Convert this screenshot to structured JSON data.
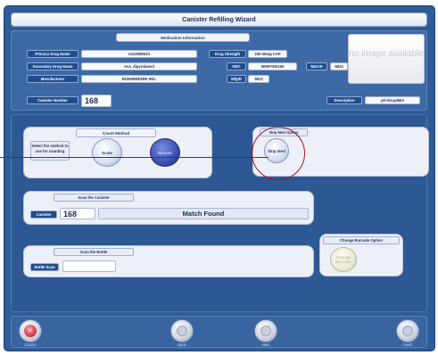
{
  "window": {
    "title": "Canister Refilling Wizard"
  },
  "medication": {
    "header": "Medication Information",
    "primary_drug_name": {
      "label": "Primary Drug Name",
      "value": "AGGRENOX"
    },
    "secondary_drug_name": {
      "label": "Secondary Drug Name",
      "value": "Asa_dipyridamol"
    },
    "manufacturer": {
      "label": "Manufacturer",
      "value": "BOEHRINGER ING."
    },
    "drug_strength": {
      "label": "Drug Strength",
      "value": "200-25mg CAP"
    },
    "ndc": {
      "label": "NDC",
      "value": "00597000160"
    },
    "ndcid": {
      "label": "NDCID",
      "value": "5813"
    },
    "mfgid": {
      "label": "MfgID",
      "value": "5813"
    },
    "canister_number": {
      "label": "Canister Number",
      "value": "168"
    },
    "description": {
      "label": "Description",
      "value": "yel-blcap/BIA"
    },
    "image_placeholder": "no image available"
  },
  "count_method": {
    "header": "Count Method",
    "prompt": "Select the method to use for counting",
    "scale_label": "Scale",
    "manual_label": "Manual"
  },
  "skip_med": {
    "header": "Skip Med Option",
    "button_label": "Skip Med"
  },
  "scan_canister": {
    "header": "Scan the Canister",
    "field_label": "Canister",
    "value": "168",
    "status": "Match Found"
  },
  "scan_bottle": {
    "header": "Scan the Bottle",
    "field_label": "Bottle Scan",
    "value": ""
  },
  "barcode": {
    "header": "Change Barcode Option",
    "button_label": "Change Barcode"
  },
  "footer": {
    "cancel_label": "Cancel",
    "back_label": "Back",
    "next_label": "Next",
    "finish_label": "Finish"
  },
  "colors": {
    "frame": "#2f5c96",
    "callout": "#9a1020",
    "accent_button": "#3a4fb0",
    "cancel": "#d43a4a"
  }
}
